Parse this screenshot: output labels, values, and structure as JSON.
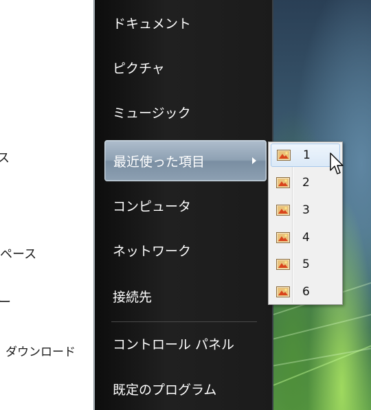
{
  "left_pane": {
    "items": [
      {
        "text": "ス"
      },
      {
        "text": "ペース"
      },
      {
        "text": "ー"
      },
      {
        "text": "ダウンロード"
      }
    ]
  },
  "start_menu": {
    "items": [
      {
        "label": "ドキュメント"
      },
      {
        "label": "ピクチャ"
      },
      {
        "label": "ミュージック"
      },
      {
        "label": "最近使った項目",
        "highlighted": true,
        "has_submenu": true
      },
      {
        "label": "コンピュータ"
      },
      {
        "label": "ネットワーク"
      },
      {
        "label": "接続先"
      },
      {
        "label": "コントロール パネル"
      },
      {
        "label": "既定のプログラム"
      }
    ]
  },
  "recent_submenu": {
    "icon": "document-image-icon",
    "items": [
      {
        "label": "1",
        "hovered": true
      },
      {
        "label": "2"
      },
      {
        "label": "3"
      },
      {
        "label": "4"
      },
      {
        "label": "5"
      },
      {
        "label": "6"
      }
    ]
  },
  "colors": {
    "menu_background": "#1b1b1b",
    "highlight": "#8ea1b3",
    "submenu_background": "#f0f0f0",
    "submenu_hover": "#dbe9f7"
  }
}
